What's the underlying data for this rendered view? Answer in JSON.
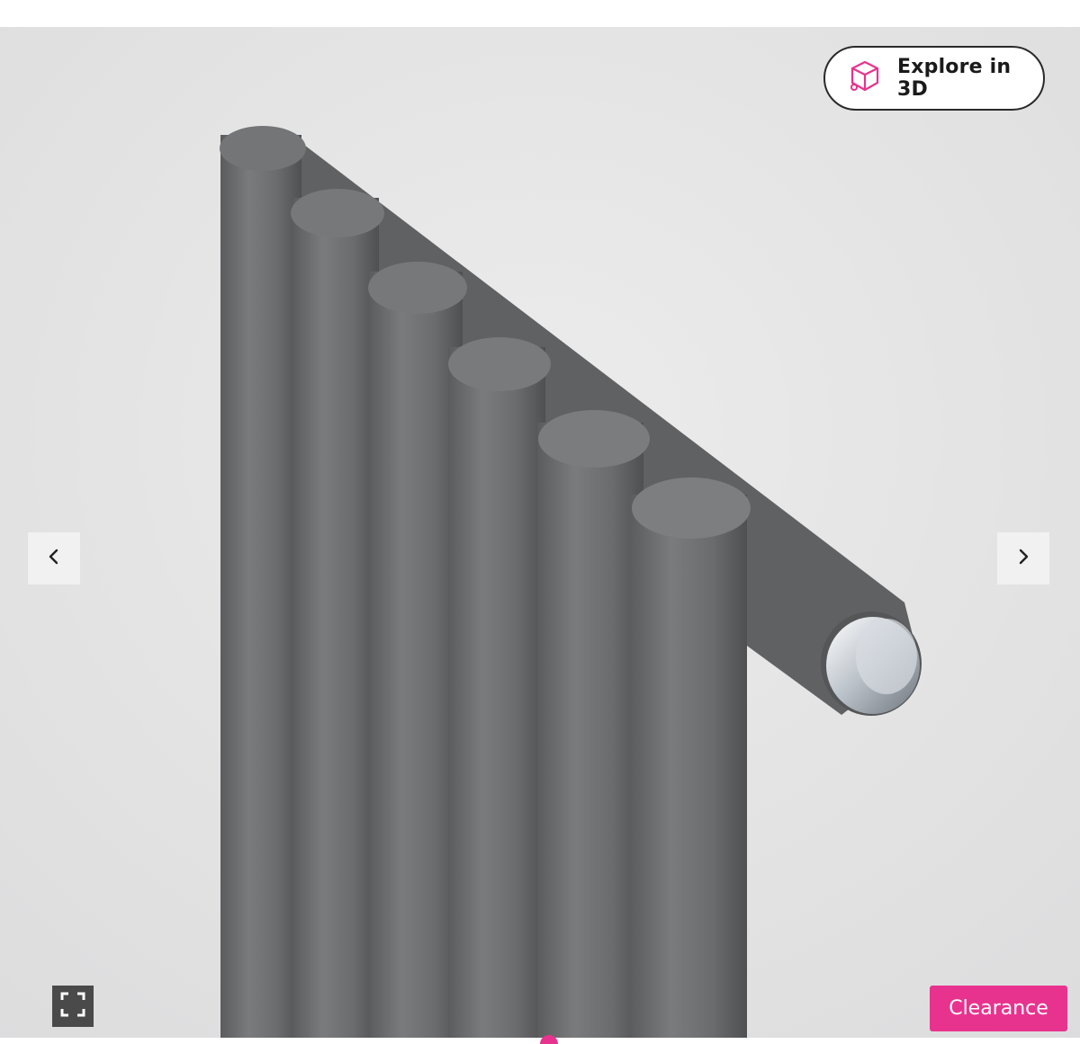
{
  "gallery": {
    "image_alt": "Anthracite vertical column radiator with chrome end cap",
    "explore_3d_label": "Explore in 3D",
    "badge": "Clearance",
    "icons": {
      "explore": "cube-3d-icon",
      "prev": "chevron-left-icon",
      "next": "chevron-right-icon",
      "fullscreen": "fullscreen-icon"
    },
    "colors": {
      "accent": "#e8338e",
      "radiator": "#6f7072",
      "background": "#e5e5e6"
    }
  }
}
